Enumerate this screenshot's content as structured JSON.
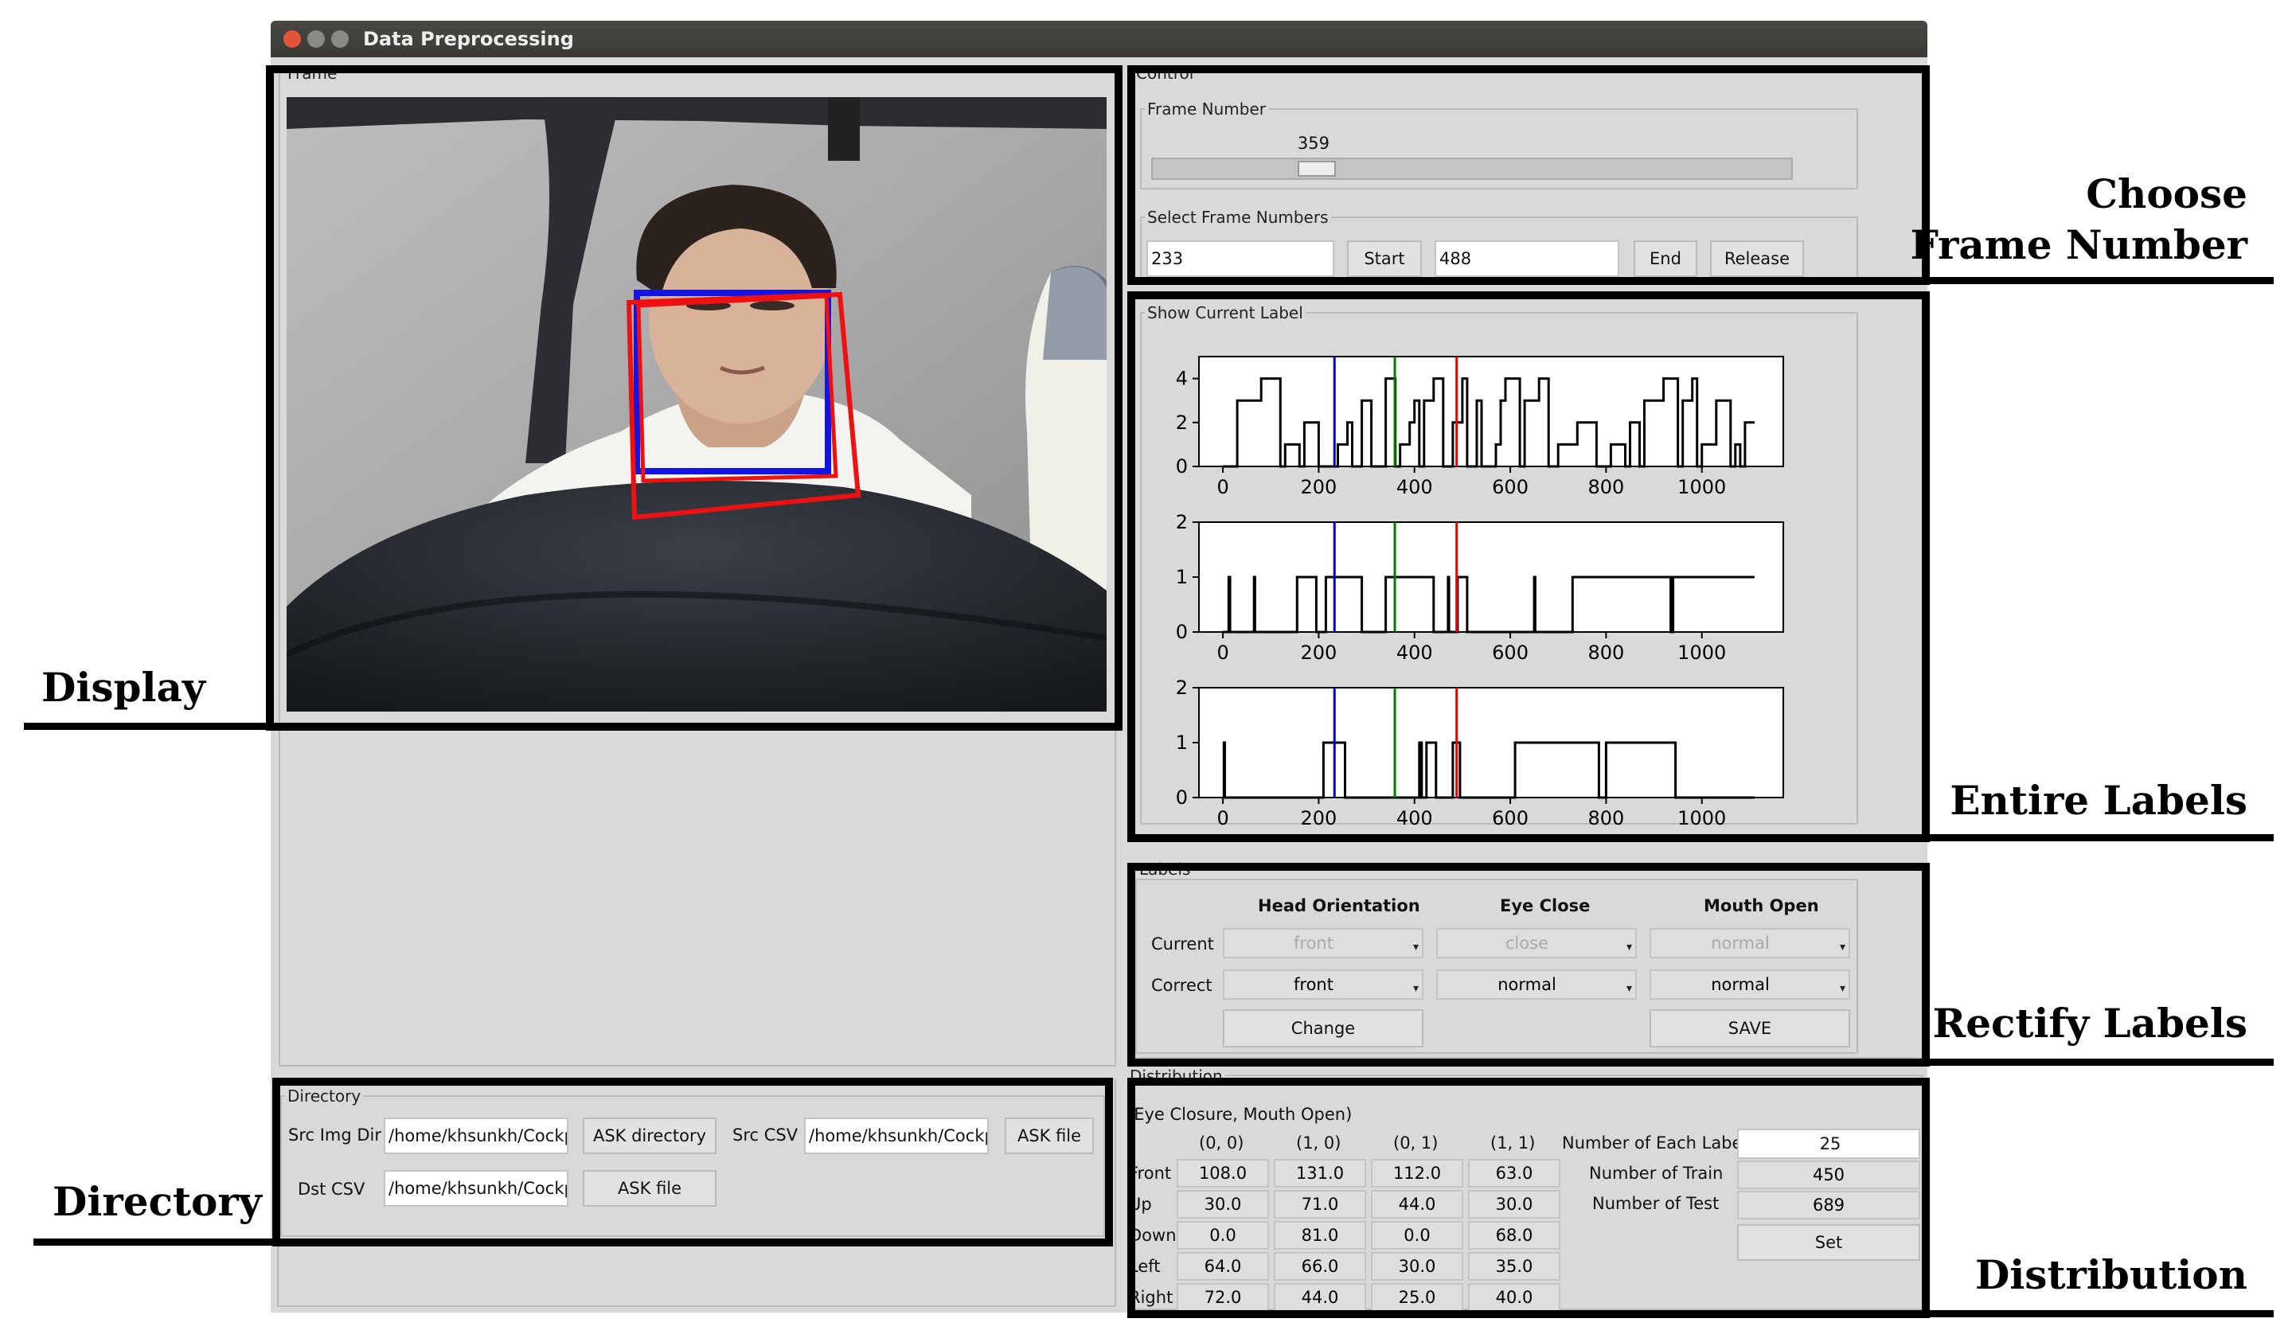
{
  "window": {
    "title": "Data Preprocessing"
  },
  "frame_panel": {
    "label": "Frame"
  },
  "control": {
    "label": "Control",
    "frame_number_label": "Frame Number",
    "frame_number_value": "359",
    "slider_fraction": 0.24,
    "select_label": "Select Frame Numbers",
    "start_value": "233",
    "start_button": "Start",
    "end_value": "488",
    "end_button": "End",
    "release_button": "Release"
  },
  "show_label": {
    "label": "Show Current Label"
  },
  "chart_data": [
    {
      "type": "line",
      "x_ticks": [
        "0",
        "200",
        "400",
        "600",
        "800",
        "1000"
      ],
      "y_ticks": [
        "0",
        "2",
        "4"
      ],
      "xlim": [
        -50,
        1170
      ],
      "ylim": [
        0,
        5
      ],
      "series": [
        {
          "color": "#000000",
          "points": [
            [
              0,
              0
            ],
            [
              30,
              0
            ],
            [
              30,
              3
            ],
            [
              60,
              3
            ],
            [
              60,
              3
            ],
            [
              80,
              3
            ],
            [
              80,
              4
            ],
            [
              120,
              4
            ],
            [
              120,
              0
            ],
            [
              130,
              0
            ],
            [
              130,
              1
            ],
            [
              160,
              1
            ],
            [
              160,
              0
            ],
            [
              170,
              0
            ],
            [
              170,
              2
            ],
            [
              200,
              2
            ],
            [
              200,
              0
            ],
            [
              240,
              0
            ],
            [
              240,
              1
            ],
            [
              260,
              1
            ],
            [
              260,
              2
            ],
            [
              270,
              2
            ],
            [
              270,
              0
            ],
            [
              290,
              0
            ],
            [
              290,
              3
            ],
            [
              310,
              3
            ],
            [
              310,
              0
            ],
            [
              340,
              0
            ],
            [
              340,
              4
            ],
            [
              360,
              4
            ],
            [
              360,
              0
            ],
            [
              370,
              0
            ],
            [
              370,
              1
            ],
            [
              390,
              1
            ],
            [
              390,
              2
            ],
            [
              400,
              2
            ],
            [
              400,
              3
            ],
            [
              410,
              3
            ],
            [
              410,
              0
            ],
            [
              420,
              0
            ],
            [
              420,
              3
            ],
            [
              440,
              3
            ],
            [
              440,
              4
            ],
            [
              460,
              4
            ],
            [
              460,
              0
            ],
            [
              480,
              0
            ],
            [
              480,
              2
            ],
            [
              500,
              2
            ],
            [
              500,
              4
            ],
            [
              510,
              4
            ],
            [
              510,
              0
            ],
            [
              530,
              0
            ],
            [
              530,
              3
            ],
            [
              540,
              3
            ],
            [
              540,
              0
            ],
            [
              570,
              0
            ],
            [
              570,
              1
            ],
            [
              580,
              1
            ],
            [
              580,
              3
            ],
            [
              590,
              3
            ],
            [
              590,
              4
            ],
            [
              620,
              4
            ],
            [
              620,
              0
            ],
            [
              630,
              0
            ],
            [
              630,
              3
            ],
            [
              660,
              3
            ],
            [
              660,
              4
            ],
            [
              680,
              4
            ],
            [
              680,
              0
            ],
            [
              700,
              0
            ],
            [
              700,
              1
            ],
            [
              740,
              1
            ],
            [
              740,
              2
            ],
            [
              780,
              2
            ],
            [
              780,
              0
            ],
            [
              810,
              0
            ],
            [
              810,
              1
            ],
            [
              840,
              1
            ],
            [
              840,
              0
            ],
            [
              850,
              0
            ],
            [
              850,
              2
            ],
            [
              870,
              2
            ],
            [
              870,
              0
            ],
            [
              880,
              0
            ],
            [
              880,
              3
            ],
            [
              920,
              3
            ],
            [
              920,
              4
            ],
            [
              950,
              4
            ],
            [
              950,
              0
            ],
            [
              960,
              0
            ],
            [
              960,
              3
            ],
            [
              980,
              3
            ],
            [
              980,
              4
            ],
            [
              990,
              4
            ],
            [
              990,
              0
            ],
            [
              1000,
              0
            ],
            [
              1000,
              1
            ],
            [
              1030,
              1
            ],
            [
              1030,
              3
            ],
            [
              1060,
              3
            ],
            [
              1060,
              0
            ],
            [
              1070,
              0
            ],
            [
              1070,
              1
            ],
            [
              1080,
              1
            ],
            [
              1080,
              0
            ],
            [
              1090,
              0
            ],
            [
              1090,
              2
            ],
            [
              1110,
              2
            ]
          ]
        }
      ],
      "markers": [
        {
          "x": 233,
          "color": "#0000cc"
        },
        {
          "x": 359,
          "color": "#007a00"
        },
        {
          "x": 488,
          "color": "#ee0000"
        }
      ]
    },
    {
      "type": "line",
      "x_ticks": [
        "0",
        "200",
        "400",
        "600",
        "800",
        "1000"
      ],
      "y_ticks": [
        "0",
        "1",
        "2"
      ],
      "xlim": [
        -50,
        1170
      ],
      "ylim": [
        0,
        2
      ],
      "series": [
        {
          "color": "#000000",
          "points": [
            [
              0,
              0
            ],
            [
              12,
              0
            ],
            [
              12,
              1
            ],
            [
              15,
              1
            ],
            [
              15,
              0
            ],
            [
              65,
              0
            ],
            [
              65,
              1
            ],
            [
              67,
              1
            ],
            [
              67,
              0
            ],
            [
              155,
              0
            ],
            [
              155,
              1
            ],
            [
              195,
              1
            ],
            [
              195,
              0
            ],
            [
              215,
              0
            ],
            [
              215,
              1
            ],
            [
              290,
              1
            ],
            [
              290,
              0
            ],
            [
              340,
              0
            ],
            [
              340,
              1
            ],
            [
              440,
              1
            ],
            [
              440,
              0
            ],
            [
              470,
              0
            ],
            [
              470,
              1
            ],
            [
              472,
              1
            ],
            [
              472,
              0
            ],
            [
              490,
              0
            ],
            [
              490,
              1
            ],
            [
              510,
              1
            ],
            [
              510,
              0
            ],
            [
              650,
              0
            ],
            [
              650,
              1
            ],
            [
              652,
              1
            ],
            [
              652,
              0
            ],
            [
              730,
              0
            ],
            [
              730,
              1
            ],
            [
              935,
              1
            ],
            [
              935,
              0
            ],
            [
              940,
              0
            ],
            [
              940,
              1
            ],
            [
              1110,
              1
            ]
          ]
        }
      ],
      "markers": [
        {
          "x": 233,
          "color": "#0000cc"
        },
        {
          "x": 359,
          "color": "#007a00"
        },
        {
          "x": 488,
          "color": "#ee0000"
        }
      ]
    },
    {
      "type": "line",
      "x_ticks": [
        "0",
        "200",
        "400",
        "600",
        "800",
        "1000"
      ],
      "y_ticks": [
        "0",
        "1",
        "2"
      ],
      "xlim": [
        -50,
        1170
      ],
      "ylim": [
        0,
        2
      ],
      "series": [
        {
          "color": "#000000",
          "points": [
            [
              0,
              0
            ],
            [
              2,
              0
            ],
            [
              2,
              1
            ],
            [
              4,
              1
            ],
            [
              4,
              0
            ],
            [
              210,
              0
            ],
            [
              210,
              1
            ],
            [
              255,
              1
            ],
            [
              255,
              0
            ],
            [
              410,
              0
            ],
            [
              410,
              1
            ],
            [
              415,
              1
            ],
            [
              415,
              0
            ],
            [
              425,
              0
            ],
            [
              425,
              1
            ],
            [
              445,
              1
            ],
            [
              445,
              0
            ],
            [
              480,
              0
            ],
            [
              480,
              1
            ],
            [
              495,
              1
            ],
            [
              495,
              0
            ],
            [
              610,
              0
            ],
            [
              610,
              1
            ],
            [
              785,
              1
            ],
            [
              785,
              0
            ],
            [
              800,
              0
            ],
            [
              800,
              1
            ],
            [
              945,
              1
            ],
            [
              945,
              0
            ],
            [
              1110,
              0
            ]
          ]
        }
      ],
      "markers": [
        {
          "x": 233,
          "color": "#0000cc"
        },
        {
          "x": 359,
          "color": "#007a00"
        },
        {
          "x": 488,
          "color": "#ee0000"
        }
      ]
    }
  ],
  "labels_panel": {
    "label": "Labels",
    "headers": [
      "Head Orientation",
      "Eye Close",
      "Mouth Open"
    ],
    "current_label": "Current",
    "current_values": [
      "front",
      "close",
      "normal"
    ],
    "correct_label": "Correct",
    "correct_values": [
      "front",
      "normal",
      "normal"
    ],
    "change_button": "Change",
    "save_button": "SAVE"
  },
  "directory": {
    "label": "Directory",
    "src_img_dir_label": "Src Img Dir",
    "src_img_dir_value": "/home/khsunkh/Cockpit_",
    "ask_directory_button": "ASK directory",
    "src_csv_label": "Src CSV",
    "src_csv_value": "/home/khsunkh/Cockpit_",
    "ask_file_button": "ASK file",
    "dst_csv_label": "Dst CSV",
    "dst_csv_value": "/home/khsunkh/Cockpit_",
    "ask_file_button2": "ASK file"
  },
  "distribution": {
    "label": "Distribution",
    "subtitle": "(Eye Closure, Mouth Open)",
    "columns": [
      "(0, 0)",
      "(1, 0)",
      "(0, 1)",
      "(1, 1)"
    ],
    "rows": [
      {
        "label": "Front",
        "values": [
          "108.0",
          "131.0",
          "112.0",
          "63.0"
        ]
      },
      {
        "label": "Up",
        "values": [
          "30.0",
          "71.0",
          "44.0",
          "30.0"
        ]
      },
      {
        "label": "Down",
        "values": [
          "0.0",
          "81.0",
          "0.0",
          "68.0"
        ]
      },
      {
        "label": "Left",
        "values": [
          "64.0",
          "66.0",
          "30.0",
          "35.0"
        ]
      },
      {
        "label": "Right",
        "values": [
          "72.0",
          "44.0",
          "25.0",
          "40.0"
        ]
      }
    ],
    "num_each_label": "Number of Each Labels",
    "num_each_value": "25",
    "num_train_label": "Number of Train",
    "num_train_value": "450",
    "num_test_label": "Number of Test",
    "num_test_value": "689",
    "set_button": "Set"
  },
  "annotations": {
    "display": "Display",
    "directory": "Directory",
    "choose_1": "Choose",
    "choose_2": "Frame Number",
    "entire": "Entire Labels",
    "rectify": "Rectify Labels",
    "distribution": "Distribution"
  }
}
